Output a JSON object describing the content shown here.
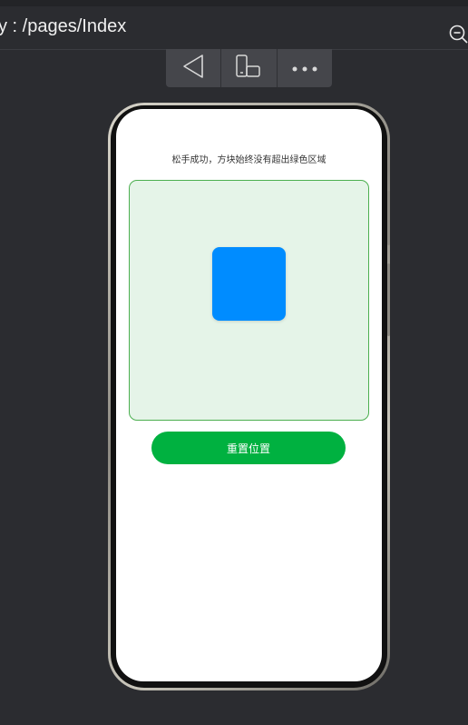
{
  "header": {
    "title": "y : /pages/Index",
    "zoom_icon": "zoom-out-icon"
  },
  "toolbar": {
    "buttons": [
      {
        "icon": "back-triangle-icon"
      },
      {
        "icon": "device-rotate-icon"
      },
      {
        "icon": "more-dots-icon"
      }
    ]
  },
  "app": {
    "status_text": "松手成功，方块始终没有超出绿色区域",
    "reset_label": "重置位置"
  },
  "colors": {
    "zone_bg": "#e5f4e8",
    "zone_border": "#4caf50",
    "block": "#008cff",
    "button": "#00b140"
  }
}
